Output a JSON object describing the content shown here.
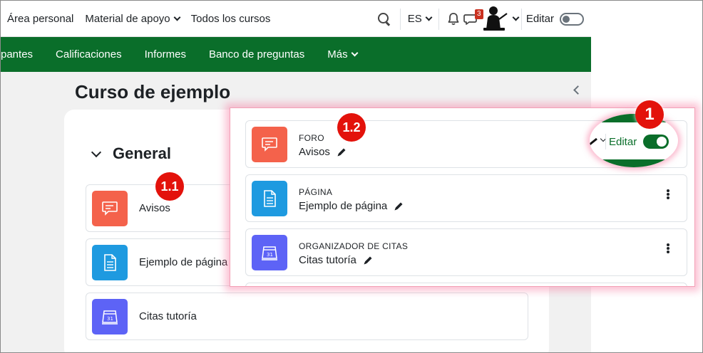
{
  "topbar": {
    "nav": [
      {
        "label": "Área personal",
        "dropdown": false
      },
      {
        "label": "Material de apoyo",
        "dropdown": true
      },
      {
        "label": "Todos los cursos",
        "dropdown": false
      }
    ],
    "language": "ES",
    "messages_badge": "3",
    "edit_label": "Editar",
    "edit_mode": false
  },
  "secondary_nav": {
    "items": [
      "pantes",
      "Calificaciones",
      "Informes",
      "Banco de preguntas",
      "Más"
    ]
  },
  "course": {
    "title": "Curso de ejemplo",
    "section_title": "General",
    "activities": [
      {
        "name": "Avisos",
        "type": "forum"
      },
      {
        "name": "Ejemplo de página",
        "type": "page"
      },
      {
        "name": "Citas tutoría",
        "type": "scheduler"
      }
    ]
  },
  "zoom": {
    "activities": [
      {
        "kind": "FORO",
        "name": "Avisos"
      },
      {
        "kind": "PÁGINA",
        "name": "Ejemplo de página"
      },
      {
        "kind": "ORGANIZADOR DE CITAS",
        "name": "Citas tutoría"
      }
    ],
    "edit_label": "Editar",
    "edit_mode": true
  },
  "callouts": [
    "1",
    "1.1",
    "1.2"
  ],
  "colors": {
    "brand_green": "#0a6e2a",
    "forum": "#f4624b",
    "page": "#1e9ae0",
    "scheduler": "#5d63f6",
    "callout": "#e3120b"
  }
}
